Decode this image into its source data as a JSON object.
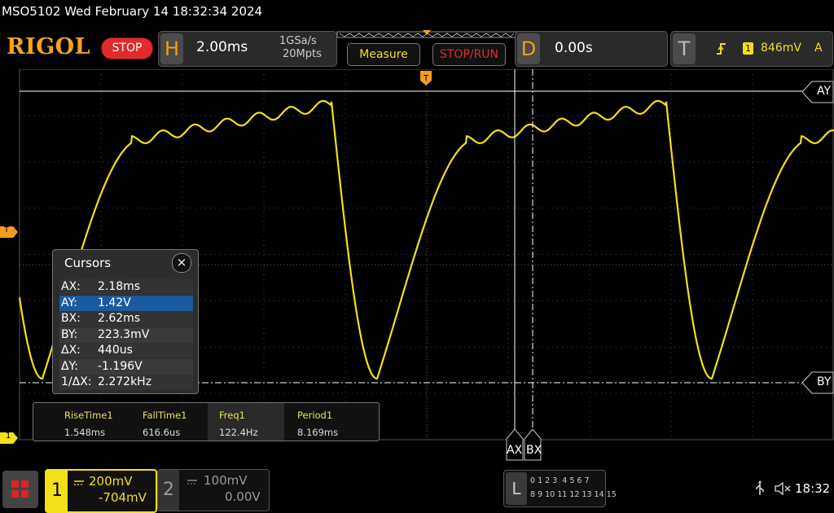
{
  "header": {
    "title": "MSO5102  Wed February 14 18:32:34 2024",
    "logo": "RIGOL",
    "run_state": "STOP",
    "horizontal": {
      "letter": "H",
      "timebase": "2.00ms",
      "sample_rate": "1GSa/s",
      "memory_depth": "20Mpts"
    },
    "measure_label": "Measure",
    "stoprun_label": "STOP/RUN",
    "delay": {
      "letter": "D",
      "value": "0.00s"
    },
    "trigger": {
      "letter": "T",
      "channel": "1",
      "level": "846mV",
      "mode": "A"
    }
  },
  "markers": {
    "trigger_level": "T",
    "channel1_ground": "1",
    "cursor_ay": "AY",
    "cursor_by": "BY",
    "cursor_ax": "AX",
    "cursor_bx": "BX"
  },
  "cursors": {
    "title": "Cursors",
    "close": "×",
    "rows": [
      {
        "key": "AX:",
        "value": "2.18ms"
      },
      {
        "key": "AY:",
        "value": "1.42V"
      },
      {
        "key": "BX:",
        "value": "2.62ms"
      },
      {
        "key": "BY:",
        "value": "223.3mV"
      },
      {
        "key": "ΔX:",
        "value": "440us"
      },
      {
        "key": "ΔY:",
        "value": "-1.196V"
      },
      {
        "key": "1/ΔX:",
        "value": "2.272kHz"
      }
    ],
    "selected_index": 1
  },
  "measurements": [
    {
      "name": "RiseTime1",
      "value": "1.548ms"
    },
    {
      "name": "FallTime1",
      "value": "616.6us"
    },
    {
      "name": "Freq1",
      "value": "122.4Hz"
    },
    {
      "name": "Period1",
      "value": "8.169ms"
    }
  ],
  "channels": {
    "ch1": {
      "number": "1",
      "scale": "200mV",
      "offset": "-704mV",
      "color": "#f2e01a"
    },
    "ch2": {
      "number": "2",
      "scale": "100mV",
      "offset": "0.00V",
      "color": "#888888"
    }
  },
  "logic": {
    "letter": "L",
    "row1": "0 1 2 3  4 5 6 7",
    "row2": "8 9 10 11 12 13 14 15"
  },
  "status": {
    "clock": "18:32"
  },
  "colors": {
    "trace": "#f2e01a",
    "accent": "#f49c1c",
    "stop": "#e02b2b"
  }
}
